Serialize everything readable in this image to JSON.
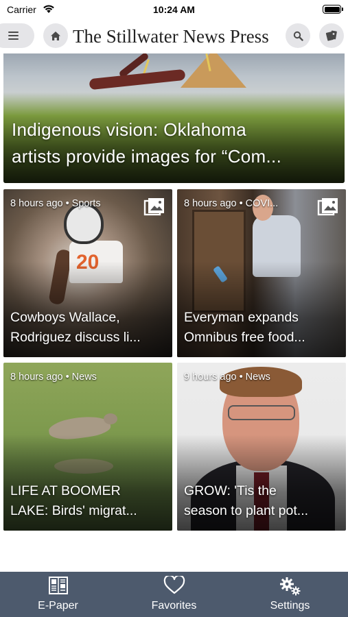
{
  "status_bar": {
    "carrier": "Carrier",
    "time": "10:24 AM"
  },
  "header": {
    "title": "The Stillwater News Press",
    "menu_icon": "hamburger-icon",
    "home_icon": "home-icon",
    "search_icon": "search-icon",
    "profile_icon": "profile-badge-icon"
  },
  "hero": {
    "headline_line1": "Indigenous vision: Oklahoma",
    "headline_line2": "artists provide images for “Com..."
  },
  "cards": [
    {
      "time": "8 hours ago",
      "section": "Sports",
      "title_line1": "Cowboys Wallace,",
      "title_line2": "Rodriguez discuss li...",
      "icon": "gallery-icon"
    },
    {
      "time": "8 hours ago",
      "section": "COVI...",
      "title_line1": "Everyman expands",
      "title_line2": "Omnibus free food...",
      "icon": "gallery-icon"
    },
    {
      "time": "8 hours ago",
      "section": "News",
      "title_line1": "LIFE AT BOOMER",
      "title_line2": "LAKE: Birds' migrat..."
    },
    {
      "time": "9 hours ago",
      "section": "News",
      "title_line1": "GROW: 'Tis the",
      "title_line2": "season to plant pot..."
    }
  ],
  "separator": "•",
  "tab_bar": {
    "items": [
      {
        "label": "E-Paper",
        "icon": "newspaper-icon"
      },
      {
        "label": "Favorites",
        "icon": "heart-icon"
      },
      {
        "label": "Settings",
        "icon": "gears-icon"
      }
    ]
  },
  "colors": {
    "tab_bar_bg": "#4d5a6d",
    "nav_button_bg": "#e5e5e8"
  }
}
